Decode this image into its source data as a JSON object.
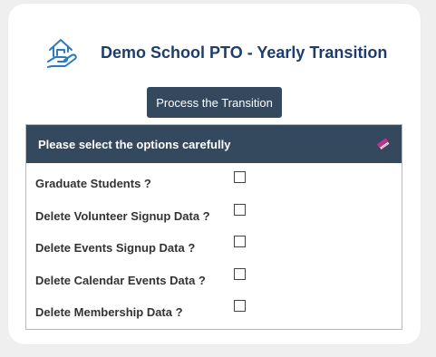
{
  "app": {
    "title": "Demo School PTO - Yearly Transition"
  },
  "toolbar": {
    "process_label": "Process the Transition"
  },
  "panel": {
    "header": "Please select the options carefully",
    "options": [
      {
        "label": "Graduate Students ?",
        "checked": false
      },
      {
        "label": "Delete Volunteer Signup Data ?",
        "checked": false
      },
      {
        "label": "Delete Events Signup Data ?",
        "checked": false
      },
      {
        "label": "Delete Calendar Events Data ?",
        "checked": false
      },
      {
        "label": "Delete Membership Data ?",
        "checked": false
      }
    ]
  },
  "icons": {
    "logo": "house-hand-icon",
    "panel_header": "book-icon"
  },
  "colors": {
    "title": "#1f3d6b",
    "button_bg": "#34495e",
    "panel_header_bg": "#34495e",
    "icon_stroke": "#2b7bbf"
  }
}
